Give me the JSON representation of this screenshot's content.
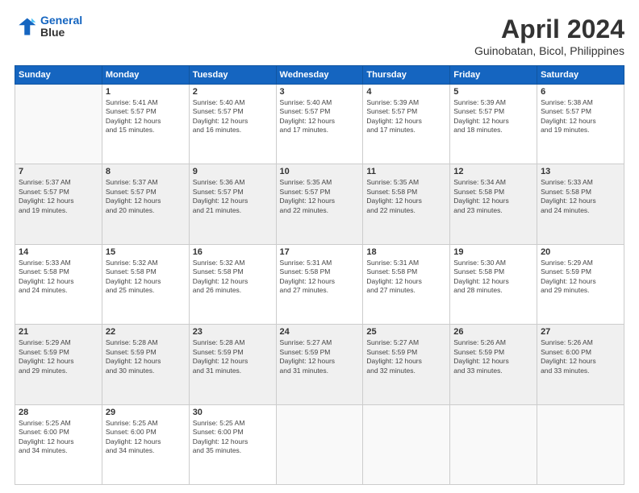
{
  "header": {
    "logo_line1": "General",
    "logo_line2": "Blue",
    "title": "April 2024",
    "subtitle": "Guinobatan, Bicol, Philippines"
  },
  "columns": [
    "Sunday",
    "Monday",
    "Tuesday",
    "Wednesday",
    "Thursday",
    "Friday",
    "Saturday"
  ],
  "weeks": [
    {
      "shaded": false,
      "days": [
        {
          "num": "",
          "detail": ""
        },
        {
          "num": "1",
          "detail": "Sunrise: 5:41 AM\nSunset: 5:57 PM\nDaylight: 12 hours\nand 15 minutes."
        },
        {
          "num": "2",
          "detail": "Sunrise: 5:40 AM\nSunset: 5:57 PM\nDaylight: 12 hours\nand 16 minutes."
        },
        {
          "num": "3",
          "detail": "Sunrise: 5:40 AM\nSunset: 5:57 PM\nDaylight: 12 hours\nand 17 minutes."
        },
        {
          "num": "4",
          "detail": "Sunrise: 5:39 AM\nSunset: 5:57 PM\nDaylight: 12 hours\nand 17 minutes."
        },
        {
          "num": "5",
          "detail": "Sunrise: 5:39 AM\nSunset: 5:57 PM\nDaylight: 12 hours\nand 18 minutes."
        },
        {
          "num": "6",
          "detail": "Sunrise: 5:38 AM\nSunset: 5:57 PM\nDaylight: 12 hours\nand 19 minutes."
        }
      ]
    },
    {
      "shaded": true,
      "days": [
        {
          "num": "7",
          "detail": "Sunrise: 5:37 AM\nSunset: 5:57 PM\nDaylight: 12 hours\nand 19 minutes."
        },
        {
          "num": "8",
          "detail": "Sunrise: 5:37 AM\nSunset: 5:57 PM\nDaylight: 12 hours\nand 20 minutes."
        },
        {
          "num": "9",
          "detail": "Sunrise: 5:36 AM\nSunset: 5:57 PM\nDaylight: 12 hours\nand 21 minutes."
        },
        {
          "num": "10",
          "detail": "Sunrise: 5:35 AM\nSunset: 5:57 PM\nDaylight: 12 hours\nand 22 minutes."
        },
        {
          "num": "11",
          "detail": "Sunrise: 5:35 AM\nSunset: 5:58 PM\nDaylight: 12 hours\nand 22 minutes."
        },
        {
          "num": "12",
          "detail": "Sunrise: 5:34 AM\nSunset: 5:58 PM\nDaylight: 12 hours\nand 23 minutes."
        },
        {
          "num": "13",
          "detail": "Sunrise: 5:33 AM\nSunset: 5:58 PM\nDaylight: 12 hours\nand 24 minutes."
        }
      ]
    },
    {
      "shaded": false,
      "days": [
        {
          "num": "14",
          "detail": "Sunrise: 5:33 AM\nSunset: 5:58 PM\nDaylight: 12 hours\nand 24 minutes."
        },
        {
          "num": "15",
          "detail": "Sunrise: 5:32 AM\nSunset: 5:58 PM\nDaylight: 12 hours\nand 25 minutes."
        },
        {
          "num": "16",
          "detail": "Sunrise: 5:32 AM\nSunset: 5:58 PM\nDaylight: 12 hours\nand 26 minutes."
        },
        {
          "num": "17",
          "detail": "Sunrise: 5:31 AM\nSunset: 5:58 PM\nDaylight: 12 hours\nand 27 minutes."
        },
        {
          "num": "18",
          "detail": "Sunrise: 5:31 AM\nSunset: 5:58 PM\nDaylight: 12 hours\nand 27 minutes."
        },
        {
          "num": "19",
          "detail": "Sunrise: 5:30 AM\nSunset: 5:58 PM\nDaylight: 12 hours\nand 28 minutes."
        },
        {
          "num": "20",
          "detail": "Sunrise: 5:29 AM\nSunset: 5:59 PM\nDaylight: 12 hours\nand 29 minutes."
        }
      ]
    },
    {
      "shaded": true,
      "days": [
        {
          "num": "21",
          "detail": "Sunrise: 5:29 AM\nSunset: 5:59 PM\nDaylight: 12 hours\nand 29 minutes."
        },
        {
          "num": "22",
          "detail": "Sunrise: 5:28 AM\nSunset: 5:59 PM\nDaylight: 12 hours\nand 30 minutes."
        },
        {
          "num": "23",
          "detail": "Sunrise: 5:28 AM\nSunset: 5:59 PM\nDaylight: 12 hours\nand 31 minutes."
        },
        {
          "num": "24",
          "detail": "Sunrise: 5:27 AM\nSunset: 5:59 PM\nDaylight: 12 hours\nand 31 minutes."
        },
        {
          "num": "25",
          "detail": "Sunrise: 5:27 AM\nSunset: 5:59 PM\nDaylight: 12 hours\nand 32 minutes."
        },
        {
          "num": "26",
          "detail": "Sunrise: 5:26 AM\nSunset: 5:59 PM\nDaylight: 12 hours\nand 33 minutes."
        },
        {
          "num": "27",
          "detail": "Sunrise: 5:26 AM\nSunset: 6:00 PM\nDaylight: 12 hours\nand 33 minutes."
        }
      ]
    },
    {
      "shaded": false,
      "days": [
        {
          "num": "28",
          "detail": "Sunrise: 5:25 AM\nSunset: 6:00 PM\nDaylight: 12 hours\nand 34 minutes."
        },
        {
          "num": "29",
          "detail": "Sunrise: 5:25 AM\nSunset: 6:00 PM\nDaylight: 12 hours\nand 34 minutes."
        },
        {
          "num": "30",
          "detail": "Sunrise: 5:25 AM\nSunset: 6:00 PM\nDaylight: 12 hours\nand 35 minutes."
        },
        {
          "num": "",
          "detail": ""
        },
        {
          "num": "",
          "detail": ""
        },
        {
          "num": "",
          "detail": ""
        },
        {
          "num": "",
          "detail": ""
        }
      ]
    }
  ]
}
